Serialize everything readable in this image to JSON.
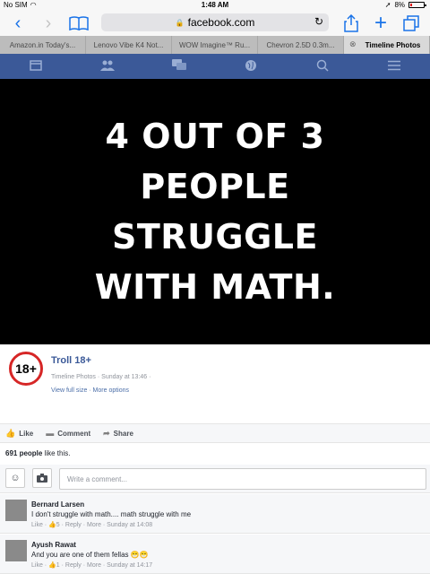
{
  "status_bar": {
    "carrier": "No SIM",
    "time": "1:48 AM",
    "battery": "8%"
  },
  "browser": {
    "url": "facebook.com",
    "tabs": [
      {
        "label": "Amazon.in Today's..."
      },
      {
        "label": "Lenovo Vibe K4 Not..."
      },
      {
        "label": "WOW Imagine™ Ru..."
      },
      {
        "label": "Chevron 2.5D 0.3m..."
      },
      {
        "label": "Timeline Photos"
      }
    ]
  },
  "fb_nav": {
    "icons": [
      "news-feed-icon",
      "friends-icon",
      "messages-icon",
      "notifications-globe-icon",
      "search-icon",
      "menu-icon"
    ]
  },
  "post": {
    "image_text_lines": [
      "4 OUT OF 3",
      "PEOPLE",
      "STRUGGLE",
      "WITH MATH."
    ],
    "page_badge": "18+",
    "page_name": "Troll 18+",
    "meta": "Timeline Photos · Sunday at 13:46 ·",
    "meta_links": "View full size · More options"
  },
  "actions": {
    "like": "Like",
    "comment": "Comment",
    "share": "Share"
  },
  "likes": {
    "count": "691 people",
    "suffix": " like this."
  },
  "composer": {
    "placeholder": "Write a comment..."
  },
  "comments": [
    {
      "author": "Bernard Larsen",
      "text": "I don't struggle with math.... math struggle with me",
      "meta": "Like · 👍5 · Reply · More · Sunday at 14:08"
    },
    {
      "author": "Ayush Rawat",
      "text": "And you are one of them fellas 😁😁",
      "meta": "Like · 👍1 · Reply · More · Sunday at 14:17"
    }
  ],
  "colors": {
    "facebook_blue": "#3b5998",
    "badge_red": "#d62626",
    "ios_blue": "#1a73e8"
  }
}
